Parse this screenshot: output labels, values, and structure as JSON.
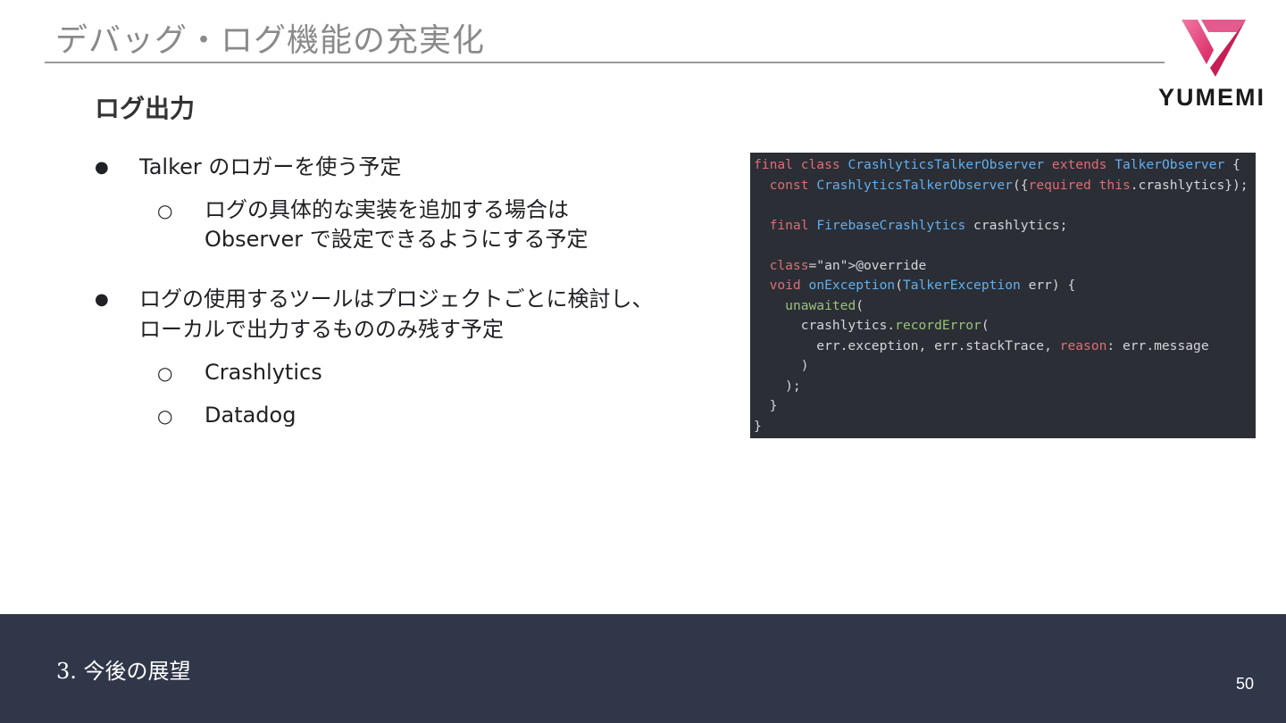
{
  "header": {
    "title": "デバッグ・ログ機能の充実化",
    "logo_text": "YUMEMI"
  },
  "content": {
    "heading": "ログ出力",
    "bullets": [
      {
        "marker": "●",
        "lines": [
          "Talker のロガーを使う予定"
        ],
        "children": [
          {
            "marker": "○",
            "lines": [
              "ログの具体的な実装を追加する場合は",
              "Observer で設定できるようにする予定"
            ]
          }
        ]
      },
      {
        "marker": "●",
        "lines": [
          "ログの使用するツールはプロジェクトごとに検討し、",
          "ローカルで出力するもののみ残す予定"
        ],
        "children": [
          {
            "marker": "○",
            "lines": [
              "Crashlytics"
            ]
          },
          {
            "marker": "○",
            "lines": [
              "Datadog"
            ]
          }
        ]
      }
    ]
  },
  "code": {
    "lines": [
      "final class CrashlyticsTalkerObserver extends TalkerObserver {",
      "  const CrashlyticsTalkerObserver({required this.crashlytics});",
      "",
      "  final FirebaseCrashlytics crashlytics;",
      "",
      "  @override",
      "  void onException(TalkerException err) {",
      "    unawaited(",
      "      crashlytics.recordError(",
      "        err.exception, err.stackTrace, reason: err.message",
      "      )",
      "    );",
      "  }",
      "}"
    ]
  },
  "footer": {
    "section": "3. 今後の展望",
    "page_number": "50"
  },
  "colors": {
    "footer_bg": "#303749",
    "code_bg": "#2b2e35",
    "logo_pink": "#e8407a"
  }
}
